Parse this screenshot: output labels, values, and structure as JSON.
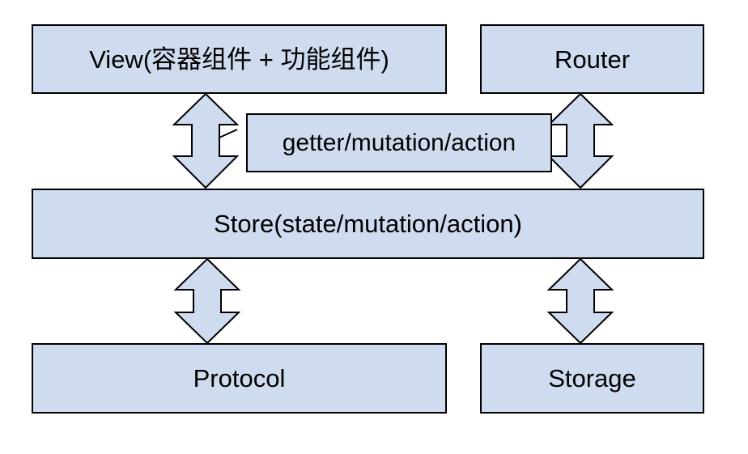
{
  "diagram": {
    "view_label": "View(容器组件 + 功能组件)",
    "router_label": "Router",
    "store_label": "Store(state/mutation/action)",
    "protocol_label": "Protocol",
    "storage_label": "Storage",
    "connector_label": "getter/mutation/action"
  }
}
